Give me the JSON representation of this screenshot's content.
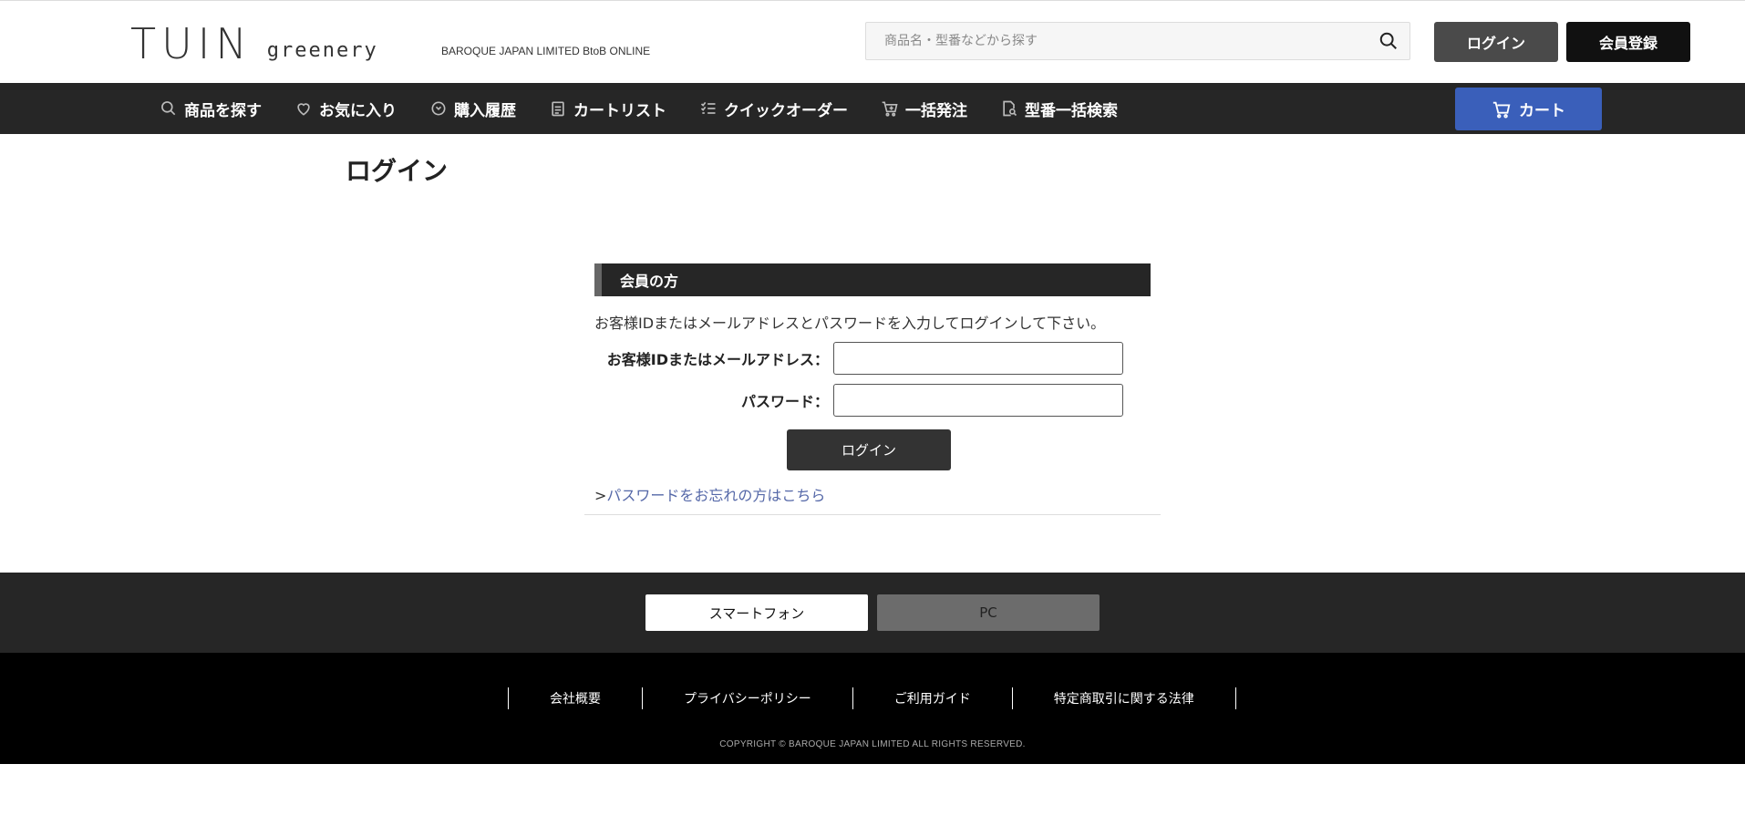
{
  "header": {
    "logo_main": "TUIN",
    "logo_sub": "greenery",
    "tagline": "BAROQUE JAPAN LIMITED BtoB ONLINE",
    "search_placeholder": "商品名・型番などから探す",
    "login_label": "ログイン",
    "register_label": "会員登録"
  },
  "nav": {
    "items": [
      {
        "label": "商品を探す",
        "icon": "search-icon"
      },
      {
        "label": "お気に入り",
        "icon": "heart-icon"
      },
      {
        "label": "購入履歴",
        "icon": "clock-icon"
      },
      {
        "label": "カートリスト",
        "icon": "clipboard-icon"
      },
      {
        "label": "クイックオーダー",
        "icon": "checklist-icon"
      },
      {
        "label": "一括発注",
        "icon": "cart-plus-icon"
      },
      {
        "label": "型番一括検索",
        "icon": "document-search-icon"
      }
    ],
    "cart_label": "カート"
  },
  "main": {
    "title": "ログイン",
    "section_heading": "会員の方",
    "instructions": "お客様IDまたはメールアドレスとパスワードを入力してログインして下さい。",
    "id_label": "お客様IDまたはメールアドレス：",
    "id_value": "",
    "password_label": "パスワード：",
    "password_value": "",
    "submit_label": "ログイン",
    "forgot_prefix": ">",
    "forgot_label": "パスワードをお忘れの方はこちら"
  },
  "device": {
    "smartphone_label": "スマートフォン",
    "pc_label": "PC"
  },
  "footer": {
    "links": [
      "会社概要",
      "プライバシーポリシー",
      "ご利用ガイド",
      "特定商取引に関する法律"
    ],
    "copyright": "COPYRIGHT © BAROQUE JAPAN LIMITED ALL RIGHTS RESERVED."
  },
  "colors": {
    "nav_bg": "#262626",
    "cart_button": "#3a5fba",
    "link": "#5568a8",
    "footer_bg": "#000000"
  }
}
